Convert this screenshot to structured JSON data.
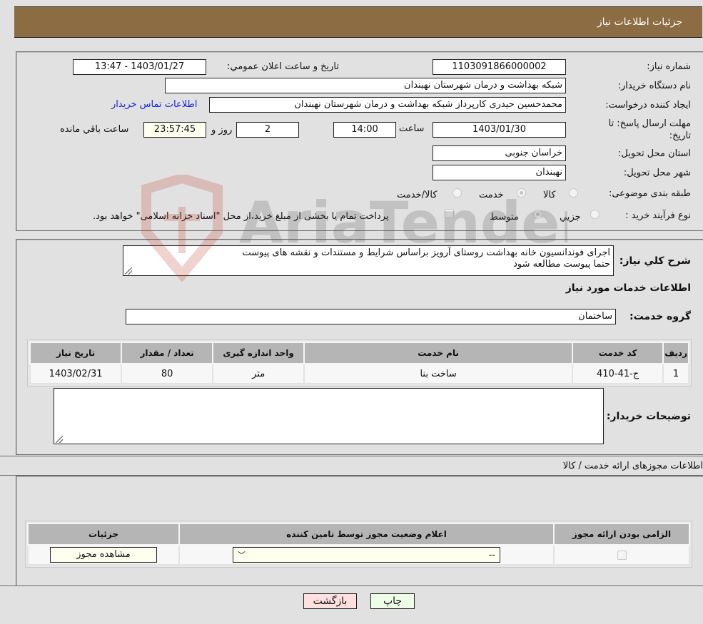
{
  "header": {
    "title": "جزئیات اطلاعات نیاز"
  },
  "form": {
    "need_number": {
      "label": "شماره نیاز:",
      "value": "1103091866000002"
    },
    "announce_datetime": {
      "label": "تاریخ و ساعت اعلان عمومي:",
      "value": "1403/01/27 - 13:47"
    },
    "buyer_org": {
      "label": "نام دستگاه خریدار:",
      "value": "شبکه بهداشت و درمان شهرستان نهبندان"
    },
    "requester": {
      "label": "ایجاد کننده درخواست:",
      "value": "محمدحسین حیدری کارپرداز شبکه بهداشت و درمان شهرستان نهبندان"
    },
    "buyer_contact_link": "اطلاعات تماس خریدار",
    "deadline": {
      "label_line1": "مهلت ارسال پاسخ: تا",
      "label_line2": "تاریخ:",
      "date": "1403/01/30",
      "time_label": "ساعت",
      "time": "14:00",
      "days": "2",
      "days_label": "روز و",
      "remaining": "23:57:45",
      "remaining_label": "ساعت باقي مانده"
    },
    "province": {
      "label": "استان محل تحویل:",
      "value": "خراسان جنوبی"
    },
    "city": {
      "label": "شهر محل تحویل:",
      "value": "نهبندان"
    },
    "category": {
      "label": "طبقه بندی موضوعی:",
      "options": [
        {
          "label": "کالا",
          "checked": false
        },
        {
          "label": "خدمت",
          "checked": true
        },
        {
          "label": "کالا/خدمت",
          "checked": false
        }
      ]
    },
    "purchase_type": {
      "label": "نوع فرآیند خرید :",
      "options": [
        {
          "label": "جزيي",
          "checked": false
        },
        {
          "label": "متوسط",
          "checked": true
        }
      ],
      "treasury_checkbox_label": "پرداخت تمام یا بخشی از مبلغ خرید،از محل \"اسناد خزانه اسلامی\" خواهد بود.",
      "treasury_checked": false
    }
  },
  "description": {
    "label": "شرح کلي نیاز:",
    "value_line1": "اجرای فوندانسیون خانه بهداشت روستای آرویز براساس شرایط و مستندات و نقشه های پیوست",
    "value_line2": "حتما پیوست مطالعه شود"
  },
  "services": {
    "section_title": "اطلاعات خدمات مورد نیاز",
    "group_label": "گروه خدمت:",
    "group_value": "ساختمان",
    "table": {
      "headers": [
        "ردیف",
        "کد خدمت",
        "نام خدمت",
        "واحد اندازه گیری",
        "تعداد / مقدار",
        "تاریخ نیاز"
      ],
      "rows": [
        [
          "1",
          "ج-41-410",
          "ساخت بنا",
          "متر",
          "80",
          "1403/02/31"
        ]
      ]
    },
    "buyer_notes_label": "توضیحات خریدار:",
    "buyer_notes_value": ""
  },
  "licenses": {
    "section_title": "اطلاعات مجوزهای ارائه خدمت / کالا",
    "table": {
      "headers": [
        "الزامی بودن ارائه مجوز",
        "اعلام وضعیت مجوز توسط تامین کننده",
        "جزئیات"
      ],
      "rows": [
        {
          "required_checked": true,
          "status_selected": "--",
          "details_button": "مشاهده مجوز"
        }
      ]
    }
  },
  "footer": {
    "print_button": "چاپ",
    "back_button": "بازگشت"
  },
  "watermark": {
    "text": "AriaTender.neT",
    "colors": {
      "shield": "#c0392b",
      "text": "#555555"
    }
  }
}
